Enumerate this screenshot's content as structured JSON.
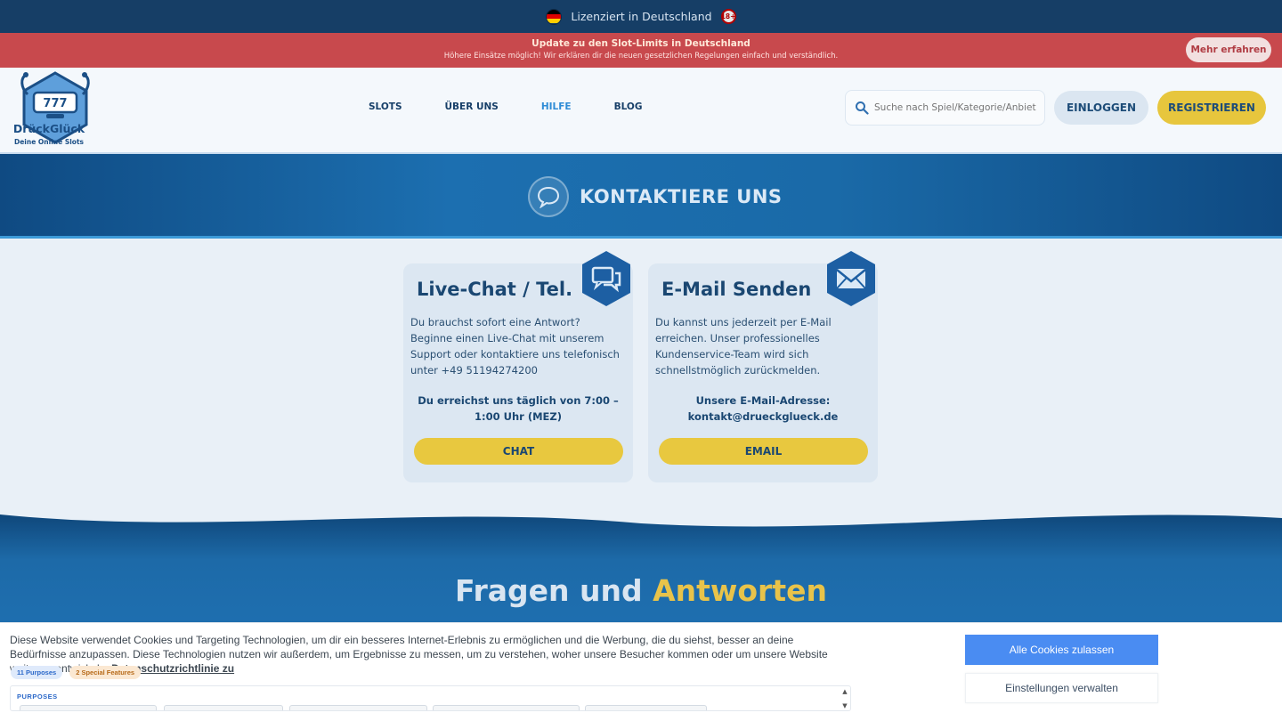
{
  "license_bar": {
    "text": "Lizenziert in Deutschland",
    "age_badge": "18+",
    "flag_colors": [
      "#000000",
      "#dd0000",
      "#ffce00"
    ]
  },
  "update_banner": {
    "title": "Update zu den Slot-Limits in Deutschland",
    "subtitle": "Höhere Einsätze möglich! Wir erklären dir die neuen gesetzlichen Regelungen einfach und verständlich.",
    "button": "Mehr erfahren"
  },
  "header": {
    "logo_name": "DrückGlück",
    "logo_tagline": "Deine Online Slots",
    "logo_reels": "777",
    "nav": [
      {
        "label": "SLOTS",
        "active": false
      },
      {
        "label": "ÜBER UNS",
        "active": false
      },
      {
        "label": "HILFE",
        "active": true
      },
      {
        "label": "BLOG",
        "active": false
      }
    ],
    "search_placeholder": "Suche nach Spiel/Kategorie/Anbiet",
    "login_label": "EINLOGGEN",
    "register_label": "REGISTRIEREN"
  },
  "hero": {
    "title": "KONTAKTIERE UNS",
    "icon": "chat-bubble-icon"
  },
  "cards": [
    {
      "title": "Live-Chat / Tel.",
      "icon": "chat-icon",
      "body": "Du brauchst sofort eine Antwort? Beginne einen Live-Chat mit unserem Support oder kontaktiere uns telefonisch unter +49 51194274200",
      "strong": "Du erreichst uns täglich von 7:00 – 1:00 Uhr (MEZ)",
      "button": "CHAT"
    },
    {
      "title": "E-Mail Senden",
      "icon": "envelope-icon",
      "body": "Du kannst uns jederzeit per E-Mail erreichen. Unser professionelles Kundenservice-Team wird sich schnellstmöglich zurückmelden.",
      "strong": "Unsere E-Mail-Adresse: kontakt@drueckglueck.de",
      "button": "EMAIL"
    }
  ],
  "faq": {
    "title_part1": "Fragen und",
    "title_part2": "Antworten"
  },
  "cookie_banner": {
    "text": "Diese Website verwendet Cookies und Targeting Technologien, um dir ein besseres Internet-Erlebnis zu ermöglichen und die Werbung, die du siehst, besser an deine Bedürfnisse anzupassen. Diese Technologien nutzen wir außerdem, um Ergebnisse zu messen, um zu verstehen, woher unsere Besucher kommen oder um unsere Website weiter zu entwickeln.",
    "privacy_link": "Datenschutzrichtlinie zu",
    "tag_purposes": "11 Purposes",
    "tag_features": "2 Special Features",
    "purposes_label": "PURPOSES",
    "accept_button": "Alle Cookies zulassen",
    "settings_button": "Einstellungen verwalten"
  },
  "colors": {
    "accent_yellow": "#e8c83f",
    "brand_blue": "#1a4772",
    "banner_red": "#c8494d",
    "active_nav": "#2f8cd6"
  }
}
